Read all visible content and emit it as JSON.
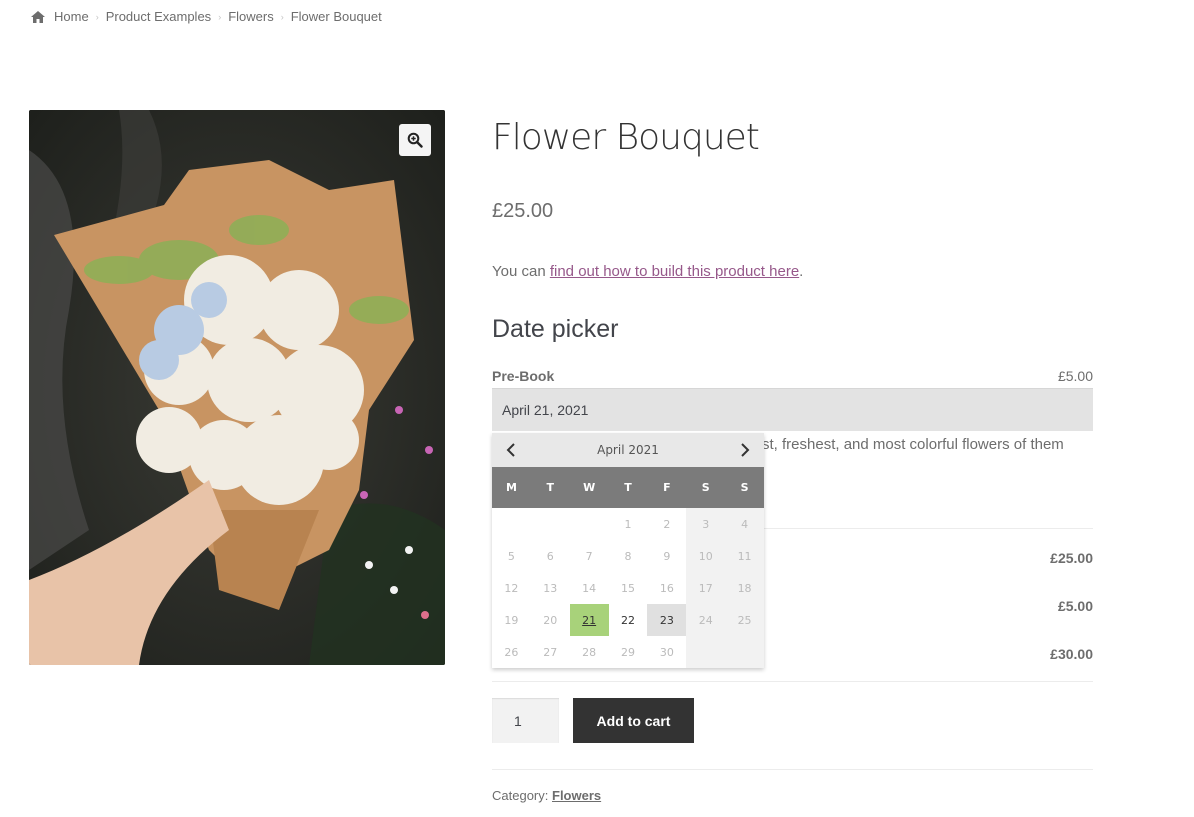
{
  "breadcrumb": {
    "icon": "home-icon",
    "items": [
      "Home",
      "Product Examples",
      "Flowers",
      "Flower Bouquet"
    ]
  },
  "gallery": {
    "image_alt": "Hand holding a bouquet of white roses and blue hydrangea wrapped in kraft paper",
    "zoom_icon": "zoom-in-icon"
  },
  "product": {
    "title": "Flower Bouquet",
    "price": "£25.00",
    "intro_prefix": "You can ",
    "intro_link": "find out how to build this product here",
    "intro_suffix": "."
  },
  "addon": {
    "section_title": "Date picker",
    "field_label": "Pre-Book",
    "field_price": "£5.00",
    "date_value": "April 21, 2021"
  },
  "description_visible": "st, freshest, and most colorful flowers of them",
  "totals": {
    "rows": [
      {
        "value": "£25.00"
      },
      {
        "value": "£5.00"
      },
      {
        "value": "£30.00"
      }
    ]
  },
  "cart": {
    "quantity": "1",
    "add_to_cart_label": "Add to cart"
  },
  "meta": {
    "category_label": "Category:",
    "category_link": "Flowers"
  },
  "calendar": {
    "month_label": "April 2021",
    "prev_icon": "chevron-left-icon",
    "next_icon": "chevron-right-icon",
    "weekdays": [
      "M",
      "T",
      "W",
      "T",
      "F",
      "S",
      "S"
    ],
    "leading_blanks": 3,
    "days_in_month": 30,
    "selected_day": 21,
    "hover_day": 23,
    "available_days": [
      21,
      22,
      23
    ],
    "colors": {
      "selected": "#a8d27a",
      "header": "#7b7b7b"
    }
  }
}
